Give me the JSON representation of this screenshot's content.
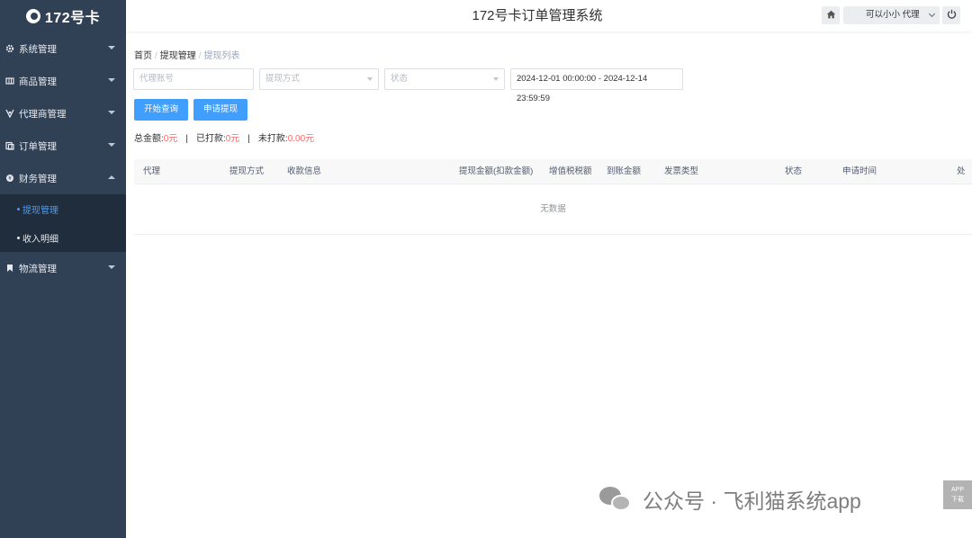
{
  "brand": {
    "logo_text": "172号卡"
  },
  "header": {
    "title": "172号卡订单管理系统",
    "home_icon": "home-icon",
    "user_name": "可以小小 代理",
    "power_icon": "power-icon"
  },
  "sidebar": {
    "items": [
      {
        "label": "系统管理",
        "icon": "gear-icon"
      },
      {
        "label": "商品管理",
        "icon": "product-icon"
      },
      {
        "label": "代理商管理",
        "icon": "agent-icon"
      },
      {
        "label": "订单管理",
        "icon": "order-icon"
      },
      {
        "label": "财务管理",
        "icon": "finance-icon"
      },
      {
        "label": "物流管理",
        "icon": "bookmark-icon"
      }
    ],
    "finance_sub": [
      {
        "label": "提现管理",
        "active": true
      },
      {
        "label": "收入明细",
        "active": false
      }
    ]
  },
  "breadcrumb": {
    "home": "首页",
    "level1": "提现管理",
    "current": "提现列表"
  },
  "filters": {
    "agent_placeholder": "代理账号",
    "method_placeholder": "提现方式",
    "status_placeholder": "状态",
    "date_range": "2024-12-01 00:00:00 - 2024-12-14 23:59:59"
  },
  "buttons": {
    "search": "开始查询",
    "apply": "申请提现"
  },
  "summary": {
    "total_label": "总金额:",
    "total_value": "0元",
    "paid_label": "已打款:",
    "paid_value": "0元",
    "unpaid_label": "未打款:",
    "unpaid_value": "0.00元",
    "separator": "|"
  },
  "table": {
    "columns": [
      "代理",
      "提现方式",
      "收款信息",
      "提现金额(扣款金额)",
      "增值税税额",
      "到账金额",
      "发票类型",
      "状态",
      "申请时间",
      "处"
    ],
    "empty_text": "无数据"
  },
  "watermark": {
    "text": "公众号 · 飞利猫系统app",
    "badge_line1": "APP",
    "badge_line2": "下载"
  },
  "colors": {
    "sidebar_bg": "#304156",
    "submenu_bg": "#1f2d3d",
    "accent": "#409eff",
    "danger": "#f56c6c"
  }
}
